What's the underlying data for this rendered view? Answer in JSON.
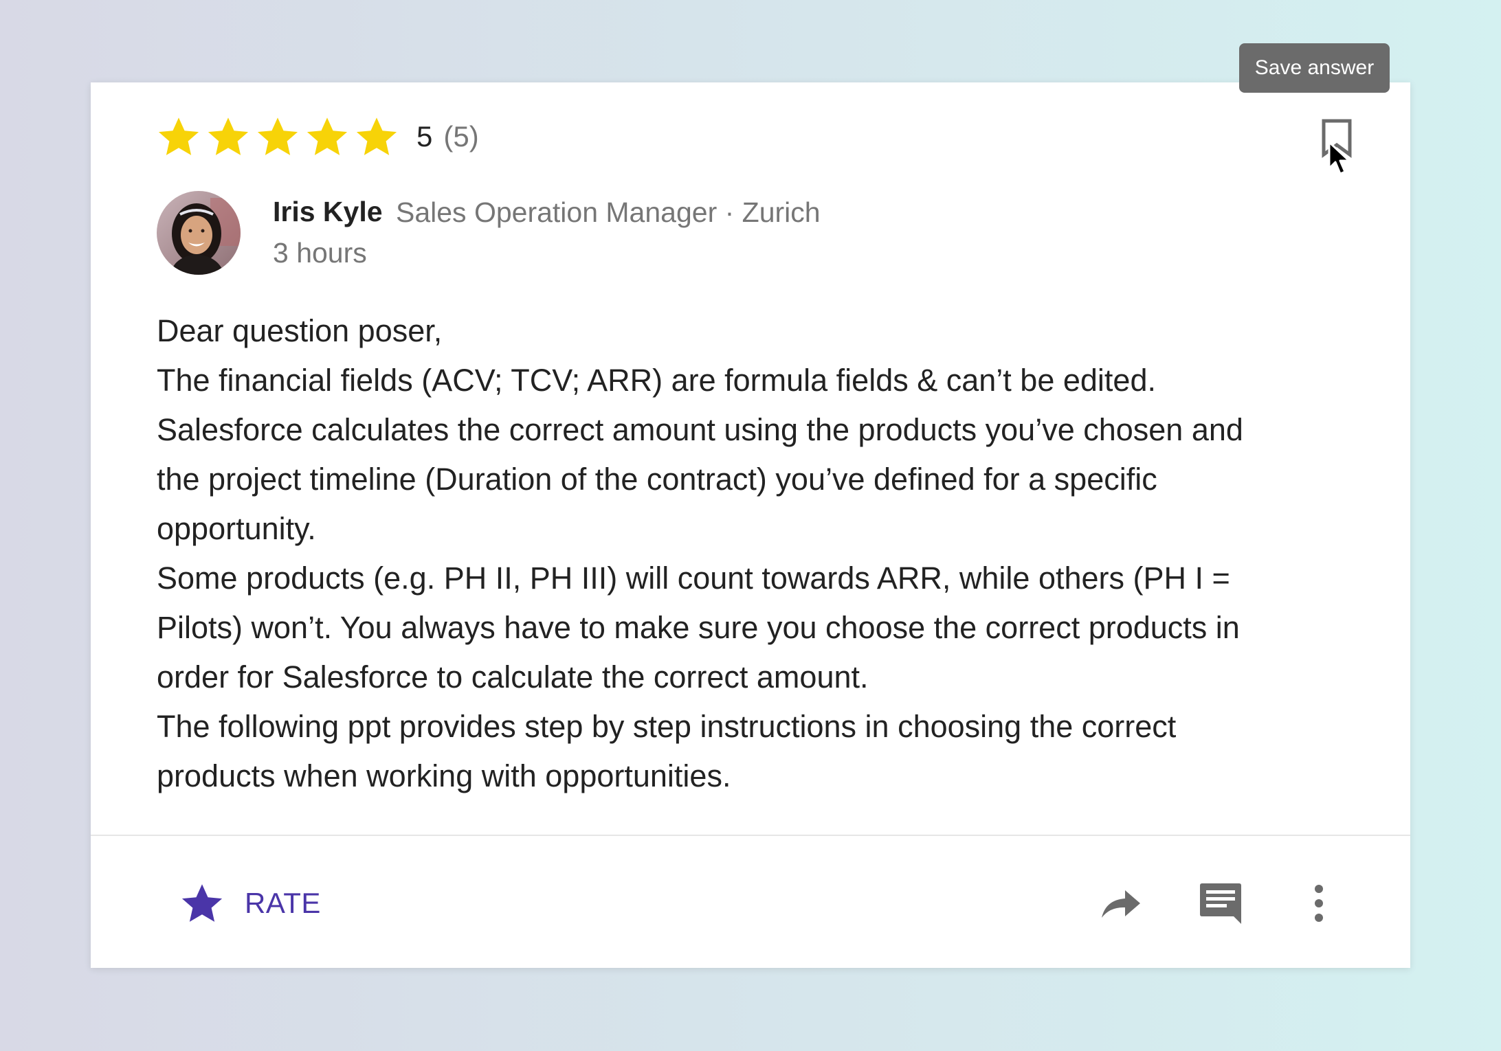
{
  "rating": {
    "stars_filled": 5,
    "stars_total": 5,
    "value": "5",
    "count": "(5)",
    "star_color": "#f7d308"
  },
  "tooltip": {
    "label": "Save answer"
  },
  "author": {
    "name": "Iris Kyle",
    "meta": "Sales Operation Manager · Zurich",
    "time": "3 hours"
  },
  "answer": {
    "lines": [
      "Dear question poser,",
      "The financial fields (ACV; TCV; ARR) are formula fields & can’t be edited.",
      "Salesforce calculates the correct amount using the products you’ve chosen and",
      "the project timeline (Duration of the contract) you’ve defined for a specific",
      "opportunity.",
      "Some products (e.g. PH II, PH III) will count towards ARR, while others (PH I =",
      "Pilots) won’t. You always have to make sure you choose the correct products in",
      "order for Salesforce to calculate the correct amount.",
      "The following ppt provides step by step instructions in choosing the correct",
      "products when working with opportunities."
    ]
  },
  "footer": {
    "rate_label": "RATE",
    "rate_color": "#4a35a8",
    "icons": [
      "share-icon",
      "comment-icon",
      "more-vert-icon"
    ]
  }
}
